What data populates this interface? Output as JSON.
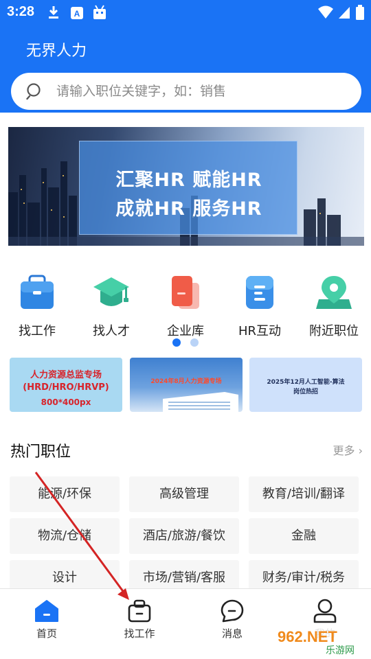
{
  "status_bar": {
    "time": "3:28"
  },
  "header": {
    "title": "无界人力"
  },
  "search": {
    "placeholder": "请输入职位关键字，如：销售"
  },
  "banner": {
    "line1": "汇聚HR  赋能HR",
    "line2": "成就HR  服务HR"
  },
  "entries": [
    {
      "label": "找工作",
      "icon": "briefcase-icon"
    },
    {
      "label": "找人才",
      "icon": "graduation-cap-icon"
    },
    {
      "label": "企业库",
      "icon": "company-cards-icon"
    },
    {
      "label": "HR互动",
      "icon": "chat-doc-icon"
    },
    {
      "label": "附近职位",
      "icon": "location-pin-icon"
    }
  ],
  "pager": {
    "active_index": 0,
    "count": 2
  },
  "promos": [
    {
      "line1": "人力资源总监专场",
      "line2": "(HRD/HRO/HRVP)",
      "line3": "800*400px"
    },
    {
      "line1": "2024年8月人力资源专场"
    },
    {
      "line1": "2025年12月人工智能-算法",
      "line2": "岗位热招"
    }
  ],
  "hot_positions": {
    "title": "热门职位",
    "more": "更多",
    "tags": [
      "能源/环保",
      "高级管理",
      "教育/培训/翻译",
      "物流/仓储",
      "酒店/旅游/餐饮",
      "金融",
      "设计",
      "市场/营销/客服",
      "财务/审计/税务"
    ]
  },
  "bottom_nav": [
    {
      "label": "首页",
      "icon": "home-icon",
      "active": true
    },
    {
      "label": "找工作",
      "icon": "briefcase-icon",
      "active": false
    },
    {
      "label": "消息",
      "icon": "message-icon",
      "active": false
    },
    {
      "label": "我的",
      "icon": "profile-icon",
      "active": false
    }
  ],
  "watermark": {
    "brand": "962.NET",
    "sub": "乐游网"
  },
  "colors": {
    "primary": "#1a73f5",
    "active_nav": "#1a73f5",
    "arrow": "#d42424"
  }
}
